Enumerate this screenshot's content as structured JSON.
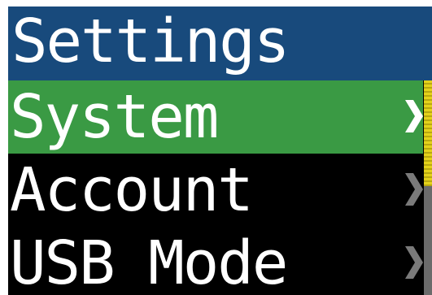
{
  "header": {
    "title": "Settings"
  },
  "menu": {
    "items": [
      {
        "label": "System",
        "selected": true
      },
      {
        "label": "Account",
        "selected": false
      },
      {
        "label": "USB Mode",
        "selected": false
      }
    ]
  },
  "colors": {
    "header_bg": "#184a7c",
    "screen_bg": "#000000",
    "selected_bg": "#3a9a44",
    "text": "#ffffff",
    "chevron_selected": "#ffffff",
    "chevron_normal": "#7a7a7a",
    "scroll_thumb": "#e4d21a",
    "scroll_track": "#6b6b6b"
  },
  "icons": {
    "chevron": "chevron-right-icon"
  }
}
